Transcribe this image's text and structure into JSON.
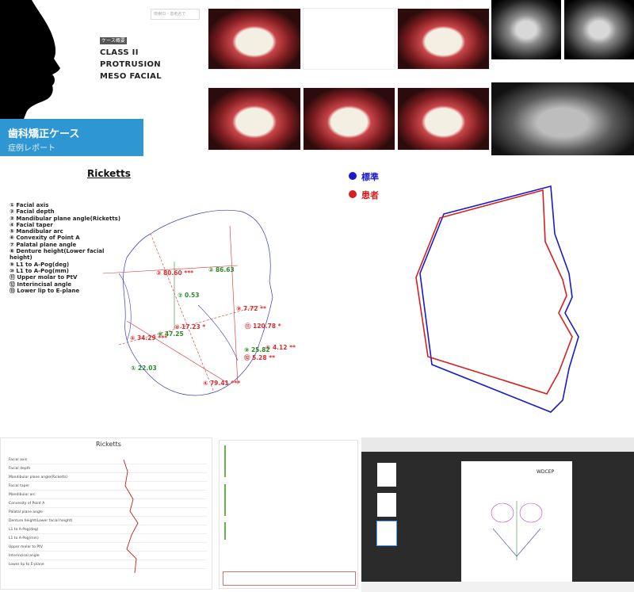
{
  "cover": {
    "search_placeholder": "検索ID・患者名で",
    "tag": "ケース概要",
    "lines": [
      "CLASS II",
      "PROTRUSION",
      "MESO FACIAL"
    ],
    "title": "歯科矯正ケース",
    "subtitle": "症例レポート"
  },
  "ricketts": {
    "title": "Ricketts",
    "measures": [
      "① Facial axis",
      "② Facial depth",
      "③ Mandibular plane angle(Ricketts)",
      "④ Facial taper",
      "⑤ Mandibular arc",
      "⑥ Convexity of Point A",
      "⑦ Palatal plane angle",
      "⑧ Denture height(Lower facial height)",
      "⑨ L1 to A-Pog(deg)",
      "⑩ L1 to A-Pog(mm)",
      "⑪ Upper molar to PtV",
      "⑫ Interincisal angle",
      "⑬ Lower lip to E-plane"
    ],
    "values": [
      {
        "text": "③ 80.60 ***",
        "color": "#d63030"
      },
      {
        "text": "② 86.63",
        "color": "#2a8a2a"
      },
      {
        "text": "⑦ 0.53",
        "color": "#2a8a2a"
      },
      {
        "text": "⑨ 7.72 **",
        "color": "#d63030"
      },
      {
        "text": "⑪ 120.78 *",
        "color": "#d63030"
      },
      {
        "text": "⑤ 34.29 ***",
        "color": "#d63030"
      },
      {
        "text": "⑧ 47.25",
        "color": "#2a8a2a"
      },
      {
        "text": "⑩ 17.23 *",
        "color": "#d63030"
      },
      {
        "text": "⑥ 4.12 **",
        "color": "#d63030"
      },
      {
        "text": "⑨ 25.82",
        "color": "#2a8a2a"
      },
      {
        "text": "⑫ 5.28 **",
        "color": "#d63030"
      },
      {
        "text": "① 22.03",
        "color": "#2a8a2a"
      },
      {
        "text": "④ 79.41 ***",
        "color": "#d63030"
      }
    ]
  },
  "legend": [
    {
      "label": "標準",
      "color": "#1a1acc"
    },
    {
      "label": "患者",
      "color": "#d62020"
    }
  ],
  "table": {
    "title": "Ricketts",
    "rows": [
      "Facial axis",
      "Facial depth",
      "Mandibular plane angle(Ricketts)",
      "Facial taper",
      "Mandibular arc",
      "Convexity of Point A",
      "Palatal plane angle",
      "Denture height(Lower facial height)",
      "L1 to A-Pog(deg)",
      "L1 to A-Pog(mm)",
      "Upper molar to PtV",
      "Interincisal angle",
      "Lower lip to E-plane"
    ]
  },
  "viewer": {
    "doc_title": "WDCEP"
  }
}
